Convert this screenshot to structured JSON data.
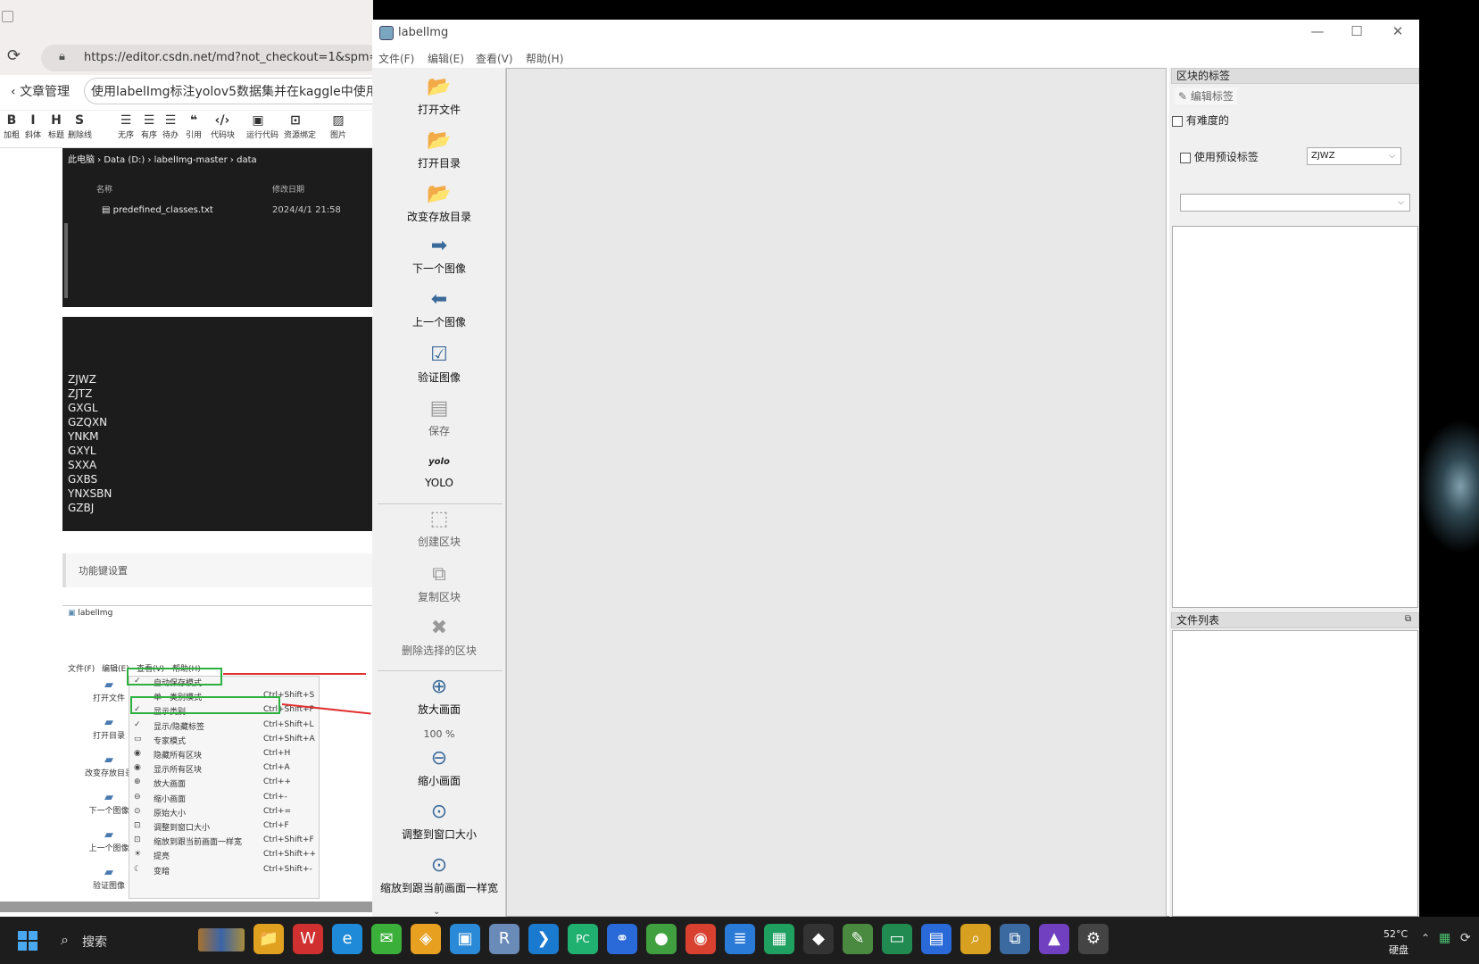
{
  "browser": {
    "url": "https://editor.csdn.net/md?not_checkout=1&spm=1",
    "back_label": "文章管理",
    "article_title": "使用labelImg标注yolov5数据集并在kaggle中使用y",
    "toolbar": [
      {
        "glyph": "B",
        "label": "加粗"
      },
      {
        "glyph": "I",
        "label": "斜体"
      },
      {
        "glyph": "H",
        "label": "标题"
      },
      {
        "glyph": "S",
        "label": "删除线"
      },
      {
        "glyph": "☰",
        "label": "无序"
      },
      {
        "glyph": "☰",
        "label": "有序"
      },
      {
        "glyph": "☰",
        "label": "待办"
      },
      {
        "glyph": "❝",
        "label": "引用"
      },
      {
        "glyph": "‹/›",
        "label": "代码块"
      },
      {
        "glyph": "▣",
        "label": "运行代码"
      },
      {
        "glyph": "⊡",
        "label": "资源绑定"
      },
      {
        "glyph": "▨",
        "label": "图片"
      }
    ],
    "explorer": {
      "breadcrumb": "此电脑  ›  Data (D:)  ›  labelImg-master  ›  data",
      "col_name": "名称",
      "col_date": "修改日期",
      "file_name": "predefined_classes.txt",
      "file_date": "2024/4/1 21:58"
    },
    "class_lines": [
      "ZJWZ",
      "ZJTZ",
      "GXGL",
      "GZQXN",
      "YNKM",
      "GXYL",
      "SXXA",
      "GXBS",
      "YNXSBN",
      "GZBJ"
    ],
    "section_title": "功能键设置",
    "embedded": {
      "title": "labelImg",
      "menus": [
        "文件(F)",
        "编辑(E)",
        "查看(V)",
        "帮助(H)"
      ],
      "left_buttons": [
        "打开文件",
        "打开目录",
        "改变存放目录",
        "下一个图像",
        "上一个图像",
        "验证图像"
      ],
      "menu_items": [
        {
          "check": "✓",
          "label": "自动保存模式",
          "shortcut": ""
        },
        {
          "check": "",
          "label": "单一类别模式",
          "shortcut": "Ctrl+Shift+S"
        },
        {
          "check": "✓",
          "label": "显示类别",
          "shortcut": "Ctrl+Shift+P"
        },
        {
          "check": "✓",
          "label": "显示/隐藏标签",
          "shortcut": "Ctrl+Shift+L"
        },
        {
          "check": "▭",
          "label": "专家模式",
          "shortcut": "Ctrl+Shift+A"
        },
        {
          "check": "◉",
          "label": "隐藏所有区块",
          "shortcut": "Ctrl+H"
        },
        {
          "check": "◉",
          "label": "显示所有区块",
          "shortcut": "Ctrl+A"
        },
        {
          "check": "⊕",
          "label": "放大画面",
          "shortcut": "Ctrl++"
        },
        {
          "check": "⊖",
          "label": "缩小画面",
          "shortcut": "Ctrl+-"
        },
        {
          "check": "⊙",
          "label": "原始大小",
          "shortcut": "Ctrl+="
        },
        {
          "check": "⊡",
          "label": "调整到窗口大小",
          "shortcut": "Ctrl+F"
        },
        {
          "check": "⊡",
          "label": "缩放到跟当前画面一样宽",
          "shortcut": "Ctrl+Shift+F"
        },
        {
          "check": "☀",
          "label": "提亮",
          "shortcut": "Ctrl+Shift++"
        },
        {
          "check": "☾",
          "label": "变暗",
          "shortcut": "Ctrl+Shift+-"
        }
      ]
    }
  },
  "labelimg": {
    "title": "labelImg",
    "window_controls": {
      "minimize": "—",
      "maximize": "☐",
      "close": "✕"
    },
    "menus": [
      "文件(F)",
      "编辑(E)",
      "查看(V)",
      "帮助(H)"
    ],
    "tools": [
      {
        "label": "打开文件",
        "icon": "folder-icon",
        "glyph": "📂",
        "disabled": false
      },
      {
        "label": "打开目录",
        "icon": "folder-icon",
        "glyph": "📂",
        "disabled": false
      },
      {
        "label": "改变存放目录",
        "icon": "folder-icon",
        "glyph": "📂",
        "disabled": false
      },
      {
        "label": "下一个图像",
        "icon": "arrow-right-icon",
        "glyph": "➡",
        "disabled": false
      },
      {
        "label": "上一个图像",
        "icon": "arrow-left-icon",
        "glyph": "⬅",
        "disabled": false
      },
      {
        "label": "验证图像",
        "icon": "checkbox-icon",
        "glyph": "☑",
        "disabled": false
      },
      {
        "label": "保存",
        "icon": "save-icon",
        "glyph": "▤",
        "disabled": true
      },
      {
        "label": "YOLO",
        "icon": "yolo-icon",
        "glyph": "yolo",
        "disabled": false
      },
      {
        "label": "创建区块",
        "icon": "create-box-icon",
        "glyph": "⬚",
        "disabled": true
      },
      {
        "label": "复制区块",
        "icon": "copy-box-icon",
        "glyph": "⧉",
        "disabled": true
      },
      {
        "label": "删除选择的区块",
        "icon": "delete-icon",
        "glyph": "✖",
        "disabled": true
      },
      {
        "label": "放大画面",
        "icon": "zoom-in-icon",
        "glyph": "⊕",
        "disabled": false
      },
      {
        "label": "缩小画面",
        "icon": "zoom-out-icon",
        "glyph": "⊖",
        "disabled": false
      },
      {
        "label": "调整到窗口大小",
        "icon": "fit-window-icon",
        "glyph": "⊙",
        "disabled": false
      },
      {
        "label": "缩放到跟当前画面一样宽",
        "icon": "fit-width-icon",
        "glyph": "⊙",
        "disabled": false
      }
    ],
    "zoom_value": "100 %",
    "more_glyph": "⌄",
    "box_labels": {
      "header": "区块的标签",
      "edit_label": "编辑标签",
      "difficult": "有难度的",
      "use_default": "使用预设标签",
      "default_value": "ZJWZ",
      "second_combo": ""
    },
    "file_list": {
      "header": "文件列表",
      "float_glyph": "⧉"
    }
  },
  "taskbar": {
    "search": "搜索",
    "temp": "52°C",
    "disk": "硬盘",
    "apps": [
      {
        "name": "file-explorer-icon",
        "glyph": "📁",
        "bg": "#e0a020"
      },
      {
        "name": "wps-icon",
        "glyph": "W",
        "bg": "#d03030"
      },
      {
        "name": "edge-icon",
        "glyph": "e",
        "bg": "#1e8ad8"
      },
      {
        "name": "wechat-icon",
        "glyph": "✉",
        "bg": "#3ab03a"
      },
      {
        "name": "shield-icon",
        "glyph": "◈",
        "bg": "#e8a020"
      },
      {
        "name": "remote-icon",
        "glyph": "▣",
        "bg": "#2a8ad8"
      },
      {
        "name": "r-icon",
        "glyph": "R",
        "bg": "#6a8ab8"
      },
      {
        "name": "vscode-icon",
        "glyph": "❯",
        "bg": "#1a7ad0"
      },
      {
        "name": "pycharm-icon",
        "glyph": "PC",
        "bg": "#20b070"
      },
      {
        "name": "link-icon",
        "glyph": "⚭",
        "bg": "#2a6ad8"
      },
      {
        "name": "ball-icon",
        "glyph": "●",
        "bg": "#40a040"
      },
      {
        "name": "chrome-icon",
        "glyph": "◉",
        "bg": "#d84030"
      },
      {
        "name": "notes-icon",
        "glyph": "≣",
        "bg": "#2a7ad8"
      },
      {
        "name": "store-icon",
        "glyph": "▦",
        "bg": "#20a060"
      },
      {
        "name": "git-icon",
        "glyph": "◆",
        "bg": "#333"
      },
      {
        "name": "tool-icon",
        "glyph": "✎",
        "bg": "#4a8a40"
      },
      {
        "name": "monitor-icon",
        "glyph": "▭",
        "bg": "#208a50"
      },
      {
        "name": "doc-icon",
        "glyph": "▤",
        "bg": "#2a6ad8"
      },
      {
        "name": "search-file-icon",
        "glyph": "⌕",
        "bg": "#d8a020"
      },
      {
        "name": "python-icon",
        "glyph": "⧉",
        "bg": "#3a6aa0"
      },
      {
        "name": "photos-icon",
        "glyph": "▲",
        "bg": "#7040c0"
      },
      {
        "name": "settings-icon",
        "glyph": "⚙",
        "bg": "#444"
      }
    ]
  }
}
